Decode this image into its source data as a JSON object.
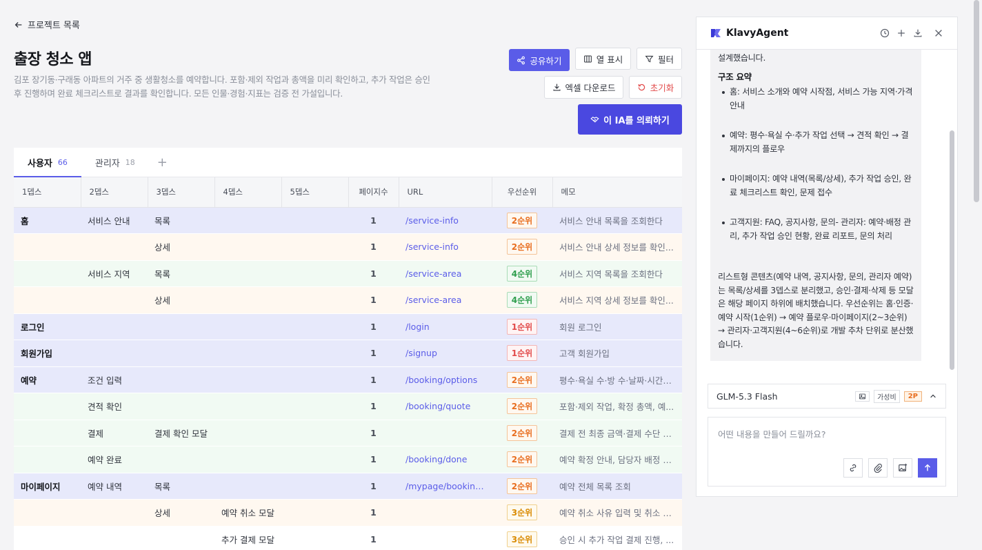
{
  "nav": {
    "back_label": "프로젝트 목록"
  },
  "page": {
    "title": "출장 청소 앱",
    "description": "김포 장기동·구래동 아파트의 거주 중 생활청소를 예약합니다. 포함·제외 작업과 총액을 미리 확인하고, 추가 작업은 승인 후 진행하며 완료 체크리스트로 결과를 확인합니다. 모든 인물·경험·지표는 검증 전 가설입니다."
  },
  "toolbar": {
    "share": "공유하기",
    "columns": "열 표시",
    "filter": "필터",
    "excel": "엑셀 다운로드",
    "reset": "초기화",
    "request": "이 IA를 의뢰하기"
  },
  "tabs": [
    {
      "label": "사용자",
      "count": "66"
    },
    {
      "label": "관리자",
      "count": "18"
    }
  ],
  "table": {
    "headers": [
      "1뎁스",
      "2뎁스",
      "3뎁스",
      "4뎁스",
      "5뎁스",
      "페이지수",
      "URL",
      "우선순위",
      "메모"
    ],
    "rows": [
      {
        "d1": "홈",
        "d2": "서비스 안내",
        "d3": "목록",
        "d4": "",
        "d5": "",
        "pages": "1",
        "url": "/service-info",
        "priority": "2순위",
        "memo": "서비스 안내 목록을 조회한다"
      },
      {
        "d1": "",
        "d2": "",
        "d3": "상세",
        "d4": "",
        "d5": "",
        "pages": "1",
        "url": "/service-info",
        "priority": "2순위",
        "memo": "서비스 안내 상세 정보를 확인..."
      },
      {
        "d1": "",
        "d2": "서비스 지역",
        "d3": "목록",
        "d4": "",
        "d5": "",
        "pages": "1",
        "url": "/service-area",
        "priority": "4순위",
        "memo": "서비스 지역 목록을 조회한다"
      },
      {
        "d1": "",
        "d2": "",
        "d3": "상세",
        "d4": "",
        "d5": "",
        "pages": "1",
        "url": "/service-area",
        "priority": "4순위",
        "memo": "서비스 지역 상세 정보를 확인..."
      },
      {
        "d1": "로그인",
        "d2": "",
        "d3": "",
        "d4": "",
        "d5": "",
        "pages": "1",
        "url": "/login",
        "priority": "1순위",
        "memo": "회원 로그인"
      },
      {
        "d1": "회원가입",
        "d2": "",
        "d3": "",
        "d4": "",
        "d5": "",
        "pages": "1",
        "url": "/signup",
        "priority": "1순위",
        "memo": "고객 회원가입"
      },
      {
        "d1": "예약",
        "d2": "조건 입력",
        "d3": "",
        "d4": "",
        "d5": "",
        "pages": "1",
        "url": "/booking/options",
        "priority": "2순위",
        "memo": "평수·욕실 수·방 수·날짜·시간대..."
      },
      {
        "d1": "",
        "d2": "견적 확인",
        "d3": "",
        "d4": "",
        "d5": "",
        "pages": "1",
        "url": "/booking/quote",
        "priority": "2순위",
        "memo": "포함·제외 작업, 확정 총액, 예..."
      },
      {
        "d1": "",
        "d2": "결제",
        "d3": "결제 확인 모달",
        "d4": "",
        "d5": "",
        "pages": "1",
        "url": "",
        "priority": "2순위",
        "memo": "결제 전 최종 금액·결제 수단 확인"
      },
      {
        "d1": "",
        "d2": "예약 완료",
        "d3": "",
        "d4": "",
        "d5": "",
        "pages": "1",
        "url": "/booking/done",
        "priority": "2순위",
        "memo": "예약 확정 안내, 담당자 배정 예..."
      },
      {
        "d1": "마이페이지",
        "d2": "예약 내역",
        "d3": "목록",
        "d4": "",
        "d5": "",
        "pages": "1",
        "url": "/mypage/bookings",
        "priority": "2순위",
        "memo": "예약 전체 목록 조회"
      },
      {
        "d1": "",
        "d2": "",
        "d3": "상세",
        "d4": "예약 취소 모달",
        "d5": "",
        "pages": "1",
        "url": "",
        "priority": "3순위",
        "memo": "예약 취소 사유 입력 및 취소 확인"
      },
      {
        "d1": "",
        "d2": "",
        "d3": "",
        "d4": "추가 결제 모달",
        "d5": "",
        "pages": "1",
        "url": "",
        "priority": "3순위",
        "memo": "승인 시 추가 작업 결제 진행, ..."
      }
    ]
  },
  "agent": {
    "title": "KlavyAgent",
    "intro_tail": "설계했습니다.",
    "section_title": "구조 요약",
    "bullets": [
      "홈: 서비스 소개와 예약 시작점, 서비스 가능 지역·가격 안내",
      "예약: 평수·욕실 수·추가 작업 선택 → 견적 확인 → 결제까지의 플로우",
      "마이페이지: 예약 내역(목록/상세), 추가 작업 승인, 완료 체크리스트 확인, 문제 접수",
      "고객지원: FAQ, 공지사항, 문의- 관리자: 예약·배정 관리, 추가 작업 승인 현황, 완료 리포트, 문의 처리"
    ],
    "summary": "리스트형 콘텐츠(예약 내역, 공지사항, 문의, 관리자 예약)는 목록/상세를 3뎁스로 분리했고, 승인·결제·삭제 등 모달은 해당 페이지 하위에 배치했습니다. 우선순위는 홈·인증·예약 시작(1순위) → 예약 플로우·마이페이지(2~3순위) → 관리자·고객지원(4~6순위)로 개발 추차 단위로 분산했습니다.",
    "model_name": "GLM-5.3 Flash",
    "model_badge": "가성비",
    "model_tag": "2P",
    "input_placeholder": "어떤 내용을 만들어 드릴까요?"
  },
  "colors": {
    "accent": "#5a5ce8",
    "priority_1": "#e24a4a",
    "priority_2": "#e86d1e",
    "priority_3": "#d98a00",
    "priority_4": "#2e9e4d"
  }
}
